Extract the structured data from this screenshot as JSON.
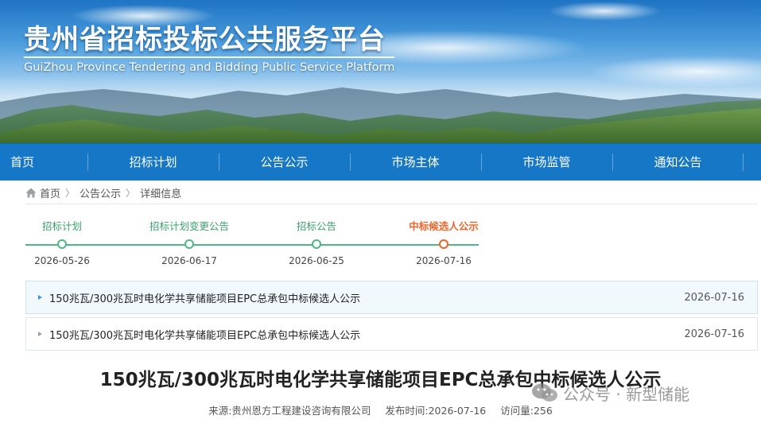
{
  "header": {
    "title": "贵州省招标投标公共服务平台",
    "subtitle": "GuiZhou Province Tendering and Bidding Public Service Platform"
  },
  "nav": {
    "items": [
      "首页",
      "招标计划",
      "公告公示",
      "市场主体",
      "市场监管",
      "通知公告"
    ]
  },
  "breadcrumb": {
    "home": "首页",
    "section": "公告公示",
    "current": "详细信息"
  },
  "timeline": {
    "steps": [
      {
        "label": "招标计划",
        "date": "2026-05-26"
      },
      {
        "label": "招标计划变更公告",
        "date": "2026-06-17"
      },
      {
        "label": "招标公告",
        "date": "2026-06-25"
      },
      {
        "label": "中标候选人公示",
        "date": "2026-07-16",
        "active": true
      }
    ]
  },
  "list": {
    "items": [
      {
        "title": "150兆瓦/300兆瓦时电化学共享储能项目EPC总承包中标候选人公示",
        "date": "2026-07-16"
      },
      {
        "title": "150兆瓦/300兆瓦时电化学共享储能项目EPC总承包中标候选人公示",
        "date": "2026-07-16"
      }
    ]
  },
  "article": {
    "title": "150兆瓦/300兆瓦时电化学共享储能项目EPC总承包中标候选人公示",
    "source": "来源:贵州恩方工程建设咨询有限公司",
    "publish_time": "发布时间:2026-07-16",
    "views": "访问量:256"
  },
  "watermark": {
    "text": "公众号 · 新型储能",
    "icon": "wechat-icon"
  },
  "colors": {
    "nav_bg": "#1577c5",
    "timeline_green": "#4fb884",
    "timeline_active": "#f0642a"
  }
}
